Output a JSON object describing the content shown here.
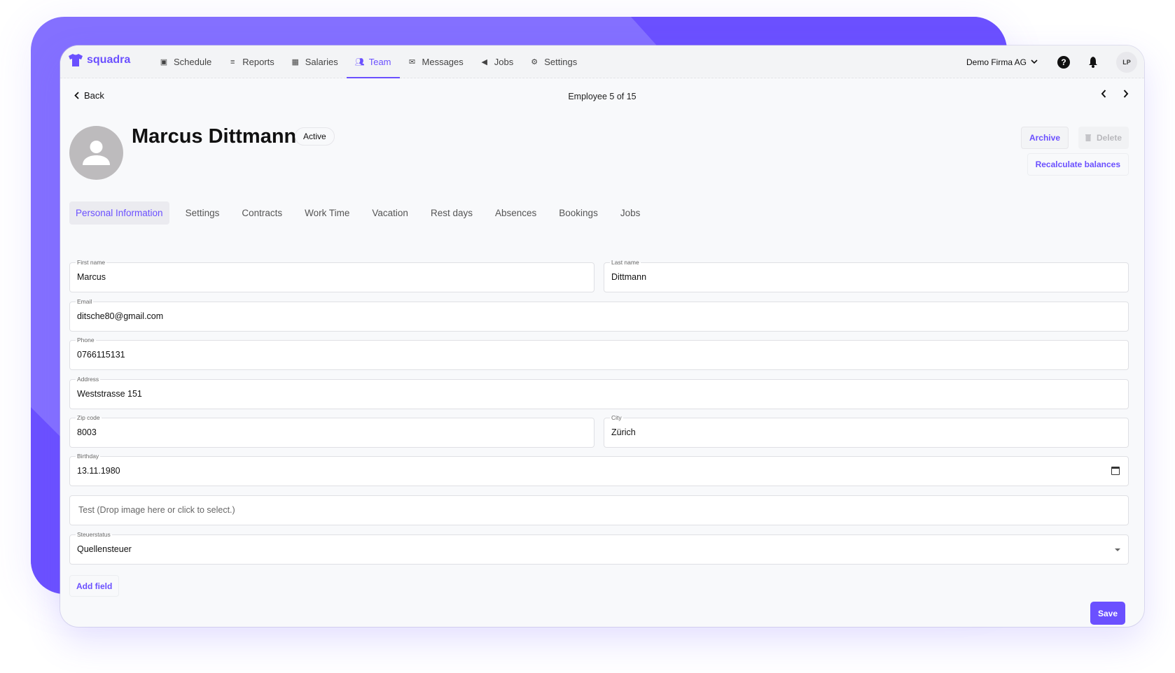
{
  "colors": {
    "accent": "#6b50ff",
    "accent_light": "#8470ff"
  },
  "header": {
    "logo_text": "squadra",
    "nav": [
      {
        "label": "Schedule",
        "icon": "calendar-icon"
      },
      {
        "label": "Reports",
        "icon": "list-icon"
      },
      {
        "label": "Salaries",
        "icon": "table-icon"
      },
      {
        "label": "Team",
        "icon": "users-icon",
        "active": true
      },
      {
        "label": "Messages",
        "icon": "mail-icon"
      },
      {
        "label": "Jobs",
        "icon": "megaphone-icon"
      },
      {
        "label": "Settings",
        "icon": "gear-icon"
      }
    ],
    "company": "Demo Firma AG",
    "help_label": "?",
    "user_initials": "LP"
  },
  "page": {
    "back_label": "Back",
    "employee_counter": "Employee 5 of 15",
    "employee_name": "Marcus Dittmann",
    "status": "Active",
    "archive_label": "Archive",
    "delete_label": "Delete",
    "recalc_label": "Recalculate balances"
  },
  "tabs": [
    {
      "label": "Personal Information",
      "active": true
    },
    {
      "label": "Settings"
    },
    {
      "label": "Contracts"
    },
    {
      "label": "Work Time"
    },
    {
      "label": "Vacation"
    },
    {
      "label": "Rest days"
    },
    {
      "label": "Absences"
    },
    {
      "label": "Bookings"
    },
    {
      "label": "Jobs"
    }
  ],
  "form": {
    "first_name": {
      "label": "First name",
      "value": "Marcus"
    },
    "last_name": {
      "label": "Last name",
      "value": "Dittmann"
    },
    "email": {
      "label": "Email",
      "value": "ditsche80@gmail.com"
    },
    "phone": {
      "label": "Phone",
      "value": "0766115131"
    },
    "address": {
      "label": "Address",
      "value": "Weststrasse 151"
    },
    "zip": {
      "label": "Zip code",
      "value": "8003"
    },
    "city": {
      "label": "City",
      "value": "Zürich"
    },
    "birthday": {
      "label": "Birthday",
      "value": "13.11.1980"
    },
    "image_drop": {
      "placeholder": "Test (Drop image here or click to select.)"
    },
    "tax_status": {
      "label": "Steuerstatus",
      "value": "Quellensteuer"
    },
    "add_field_label": "Add field",
    "save_label": "Save"
  }
}
